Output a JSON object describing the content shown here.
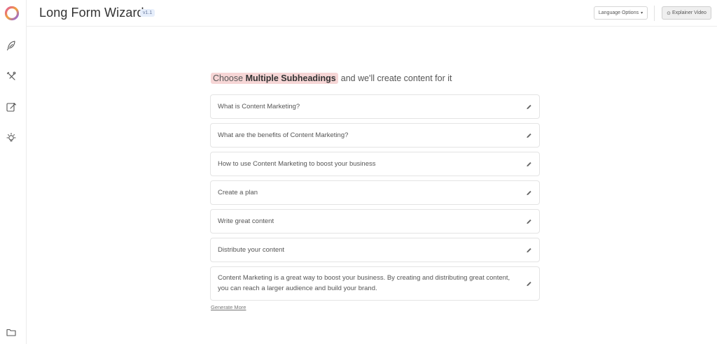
{
  "header": {
    "title": "Long Form Wizard",
    "version": "v1.1",
    "language_button": "Language Options",
    "video_button": "Explainer Video"
  },
  "sidebar": {
    "items": [
      {
        "icon": "feather-icon"
      },
      {
        "icon": "tools-icon"
      },
      {
        "icon": "edit-note-icon"
      },
      {
        "icon": "lightbulb-icon"
      },
      {
        "icon": "folder-icon"
      }
    ]
  },
  "prompt": {
    "prefix": "Choose",
    "highlight": "Multiple Subheadings",
    "suffix": "and we'll create content for it"
  },
  "subheadings": [
    "What is Content Marketing?",
    "What are the benefits of Content Marketing?",
    "How to use Content Marketing to boost your business",
    "Create a plan",
    "Write great content",
    "Distribute your content",
    "Content Marketing is a great way to boost your business. By creating and distributing great content, you can reach a larger audience and build your brand."
  ],
  "generate_more": "Generate More",
  "colors": {
    "highlight_bg": "#f6d6d6",
    "logo_gradient": [
      "#e05a9a",
      "#f2a33a",
      "#8a5cf0"
    ]
  }
}
